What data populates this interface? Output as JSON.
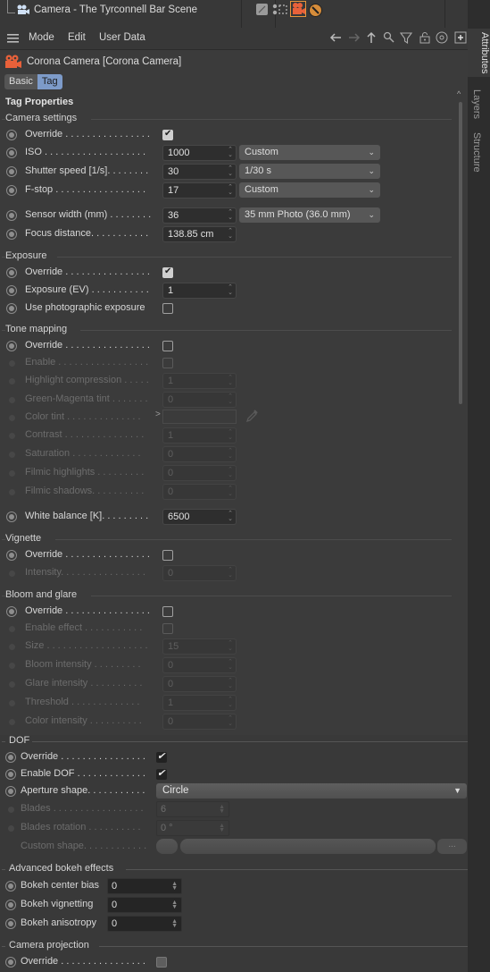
{
  "object_manager": {
    "object_name": "Camera - The Tyrconnell Bar Scene",
    "tags": [
      "display-tag-icon",
      "protection-tag-icon",
      "corona-camera-tag-icon",
      "compositing-tag-icon"
    ]
  },
  "side_tabs": [
    "Attributes",
    "Layers",
    "Structure"
  ],
  "menubar": {
    "items": [
      "Mode",
      "Edit",
      "User Data"
    ],
    "toolbar_icons": [
      "back-arrow-icon",
      "forward-arrow-icon",
      "up-arrow-icon",
      "search-icon",
      "filter-icon",
      "lock-icon",
      "target-icon",
      "new-panel-icon"
    ]
  },
  "header": {
    "object_title": "Corona Camera [Corona Camera]",
    "tabs": [
      {
        "label": "Basic",
        "active": false
      },
      {
        "label": "Tag",
        "active": true
      }
    ],
    "section_title": "Tag Properties"
  },
  "camera_settings": {
    "title": "Camera settings",
    "override_label": "Override . . . . . . . . . . . . . . . .",
    "override": true,
    "iso_label": "ISO . . . . . . . . . . . . . . . . . . .",
    "iso": "1000",
    "iso_preset": "Custom",
    "shutter_label": "Shutter speed [1/s]. . . . . . . .",
    "shutter": "30",
    "shutter_preset": "1/30 s",
    "fstop_label": "F-stop . . . . . . . . . . . . . . . . .",
    "fstop": "17",
    "fstop_preset": "Custom",
    "sensor_label": "Sensor width (mm) . . . . . . . .",
    "sensor": "36",
    "sensor_preset": "35 mm Photo (36.0 mm)",
    "focus_label": "Focus distance. . . . . . . . . . .",
    "focus": "138.85 cm"
  },
  "exposure": {
    "title": "Exposure",
    "override_label": "Override . . . . . . . . . . . . . . . .",
    "override": true,
    "ev_label": "Exposure (EV) . . . . . . . . . . .",
    "ev": "1",
    "photographic_label": "Use photographic exposure",
    "photographic": false
  },
  "tone_mapping": {
    "title": "Tone mapping",
    "override_label": "Override . . . . . . . . . . . . . . . .",
    "override": false,
    "enable_label": "Enable . . . . . . . . . . . . . . . . .",
    "highlight_label": "Highlight compression . . . . .",
    "highlight": "1",
    "gm_label": "Green-Magenta tint . . . . . . .",
    "gm": "0",
    "colortint_label": "Color tint . . . . . . . . . . . . . .",
    "contrast_label": "Contrast . . . . . . . . . . . . . . .",
    "contrast": "1",
    "saturation_label": "Saturation . . . . . . . . . . . . .",
    "saturation": "0",
    "filmic_high_label": "Filmic highlights . . . . . . . . .",
    "filmic_high": "0",
    "filmic_shadow_label": "Filmic shadows. . . . . . . . . .",
    "filmic_shadow": "0",
    "wb_label": "White balance [K]. . . . . . . . .",
    "wb": "6500"
  },
  "vignette": {
    "title": "Vignette",
    "override_label": "Override . . . . . . . . . . . . . . . .",
    "override": false,
    "intensity_label": "Intensity. . . . . . . . . . . . . . . .",
    "intensity": "0"
  },
  "bloom": {
    "title": "Bloom and glare",
    "override_label": "Override . . . . . . . . . . . . . . . .",
    "override": false,
    "enable_label": "Enable effect . . . . . . . . . . .",
    "size_label": "Size . . . . . . . . . . . . . . . . . . .",
    "size": "15",
    "bloom_label": "Bloom intensity . . . . . . . . .",
    "bloom_intensity": "0",
    "glare_label": "Glare intensity . . . . . . . . . .",
    "glare_intensity": "0",
    "threshold_label": "Threshold . . . . . . . . . . . . .",
    "threshold": "1",
    "color_label": "Color intensity . . . . . . . . . .",
    "color_intensity": "0"
  },
  "dof": {
    "title": "DOF",
    "override_label": "Override . . . . . . . . . . . . . . . .",
    "override": true,
    "enable_label": "Enable DOF . . . . . . . . . . . . .",
    "enable": true,
    "aperture_label": "Aperture shape. . . . . . . . . . .",
    "aperture": "Circle",
    "blades_label": "Blades . . . . . . . . . . . . . . . . .",
    "blades": "6",
    "rotation_label": "Blades rotation . . . . . . . . . .",
    "rotation": "0 °",
    "custom_label": "Custom shape. . . . . . . . . . . .",
    "custom_btn": "..."
  },
  "bokeh": {
    "title": "Advanced bokeh effects",
    "center_label": "Bokeh center bias",
    "center": "0",
    "vignetting_label": "Bokeh vignetting",
    "vignetting": "0",
    "anisotropy_label": "Bokeh anisotropy",
    "anisotropy": "0"
  },
  "projection": {
    "title": "Camera projection",
    "override_label": "Override . . . . . . . . . . . . . . . .",
    "override": false
  }
}
